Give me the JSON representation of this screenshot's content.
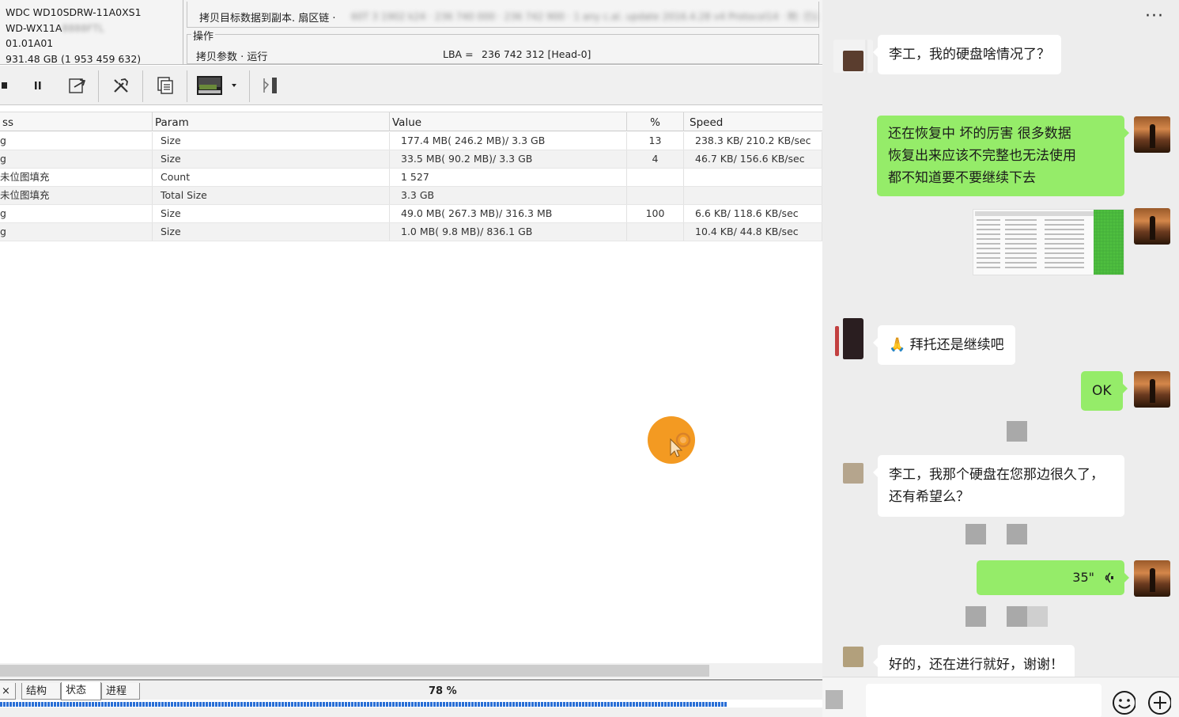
{
  "device": {
    "model": "WDC WD10SDRW-11A0XS1",
    "serial_visible": "WD-WX11A",
    "serial_hidden": "8888FTL",
    "firmware": "01.01A01",
    "capacity": "931.48 GB (1 953 459 632)"
  },
  "task": {
    "text": "拷贝目标数据到副本. 扇区链 ·",
    "blurred": "60T 3 1902 k24 · 236 740 000 · 236 742 900 · 1 any c.al. update 2016.4.28 v4 Protocol14 · 附: 已读取",
    "group_label": "操作",
    "op_text": "拷贝参数 · 运行",
    "lba_label": "LBA =",
    "lba_value": "236 742 312  [Head-0]"
  },
  "toolbar": {
    "icons": [
      "stop-icon",
      "pause-icon",
      "export-icon",
      "tools-icon",
      "copy-pages-icon",
      "image-dropdown-icon",
      "map-icon"
    ]
  },
  "table": {
    "columns": [
      "ss",
      "Param",
      "Value",
      "%",
      "Speed"
    ],
    "rows": [
      {
        "process": "g",
        "param": "Size",
        "value": "177.4 MB( 246.2 MB)/ 3.3 GB",
        "percent": "13",
        "speed": "238.3 KB/ 210.2 KB/sec"
      },
      {
        "process": "g",
        "param": "Size",
        "value": "33.5 MB( 90.2 MB)/ 3.3 GB",
        "percent": "4",
        "speed": "46.7 KB/ 156.6 KB/sec"
      },
      {
        "process": "未位图填充",
        "param": "Count",
        "value": "1 527",
        "percent": "",
        "speed": ""
      },
      {
        "process": "未位图填充",
        "param": "Total Size",
        "value": "3.3 GB",
        "percent": "",
        "speed": ""
      },
      {
        "process": "g",
        "param": "Size",
        "value": "49.0 MB( 267.3 MB)/ 316.3 MB",
        "percent": "100",
        "speed": "6.6 KB/ 118.6 KB/sec"
      },
      {
        "process": "g",
        "param": "Size",
        "value": "1.0 MB( 9.8 MB)/ 836.1 GB",
        "percent": "",
        "speed": "10.4 KB/ 44.8 KB/sec"
      }
    ]
  },
  "bottom_tabs": [
    "×",
    "结构",
    "状态",
    "进程"
  ],
  "progress": {
    "label": "78 %",
    "fraction": 0.885
  },
  "chat": {
    "more": "···",
    "messages": [
      {
        "side": "in",
        "text": "李工，我的硬盘啥情况了？"
      },
      {
        "side": "out",
        "lines": [
          "还在恢复中   坏的厉害    很多数据",
          "恢复出来应该不完整也无法使用",
          "都不知道要不要继续下去"
        ]
      },
      {
        "side": "out",
        "type": "image"
      },
      {
        "side": "in",
        "text": "🙏 拜托还是继续吧"
      },
      {
        "side": "out",
        "text": "OK"
      },
      {
        "side": "in",
        "lines": [
          "李工，我那个硬盘在您那边很久了，",
          "还有希望么？"
        ]
      },
      {
        "side": "out",
        "type": "voice",
        "text": "35\""
      },
      {
        "side": "in",
        "text": "好的，还在进行就好，谢谢！"
      }
    ]
  },
  "colors": {
    "bubble_out": "#95ec69",
    "bubble_in": "#ffffff",
    "chat_bg": "#ededed",
    "cursor": "#f39a22",
    "progress": "#2a6fd6"
  }
}
